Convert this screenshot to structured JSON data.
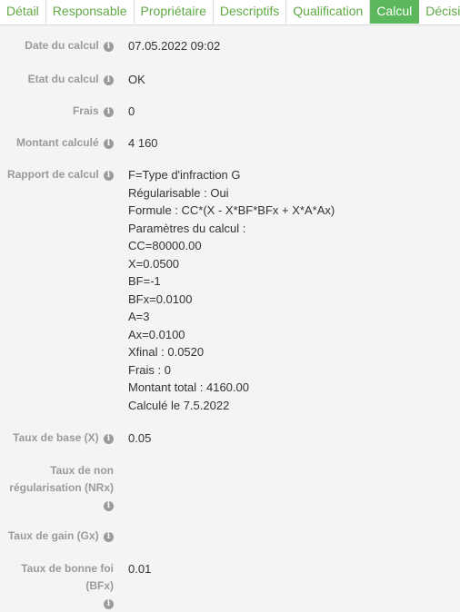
{
  "tabs": [
    {
      "label": "Détail"
    },
    {
      "label": "Responsable"
    },
    {
      "label": "Propriétaire"
    },
    {
      "label": "Descriptifs"
    },
    {
      "label": "Qualification"
    },
    {
      "label": "Calcul"
    },
    {
      "label": "Décision"
    }
  ],
  "active_tab": "Calcul",
  "fields": {
    "date_calcul": {
      "label": "Date du calcul",
      "value": "07.05.2022 09:02"
    },
    "etat_calcul": {
      "label": "Etat du calcul",
      "value": "OK"
    },
    "frais": {
      "label": "Frais",
      "value": "0"
    },
    "montant_calcule": {
      "label": "Montant calculé",
      "value": "4 160"
    },
    "rapport_calcul": {
      "label": "Rapport de calcul",
      "lines": [
        "F=Type d'infraction G",
        "Régularisable : Oui",
        "Formule : CC*(X - X*BF*BFx + X*A*Ax)",
        "Paramètres du calcul :",
        "CC=80000.00",
        "X=0.0500",
        "BF=-1",
        "BFx=0.0100",
        "A=3",
        "Ax=0.0100",
        "Xfinal : 0.0520",
        "Frais : 0",
        "Montant total : 4160.00",
        "Calculé le 7.5.2022"
      ]
    },
    "taux_base": {
      "label": "Taux de base (X)",
      "value": "0.05"
    },
    "taux_non_regularisation": {
      "label_line1": "Taux de non",
      "label_line2": "régularisation (NRx)",
      "value": ""
    },
    "taux_gain": {
      "label": "Taux de gain (Gx)",
      "value": ""
    },
    "taux_bonne_foi": {
      "label_line1": "Taux de bonne foi",
      "label_line2": "(BFx)",
      "value": "0.01"
    }
  },
  "colors": {
    "accent": "#5cb85c",
    "tab_text": "#5fa844",
    "label": "#9a9a9a"
  },
  "icons": {
    "info": "info-circle-icon"
  }
}
